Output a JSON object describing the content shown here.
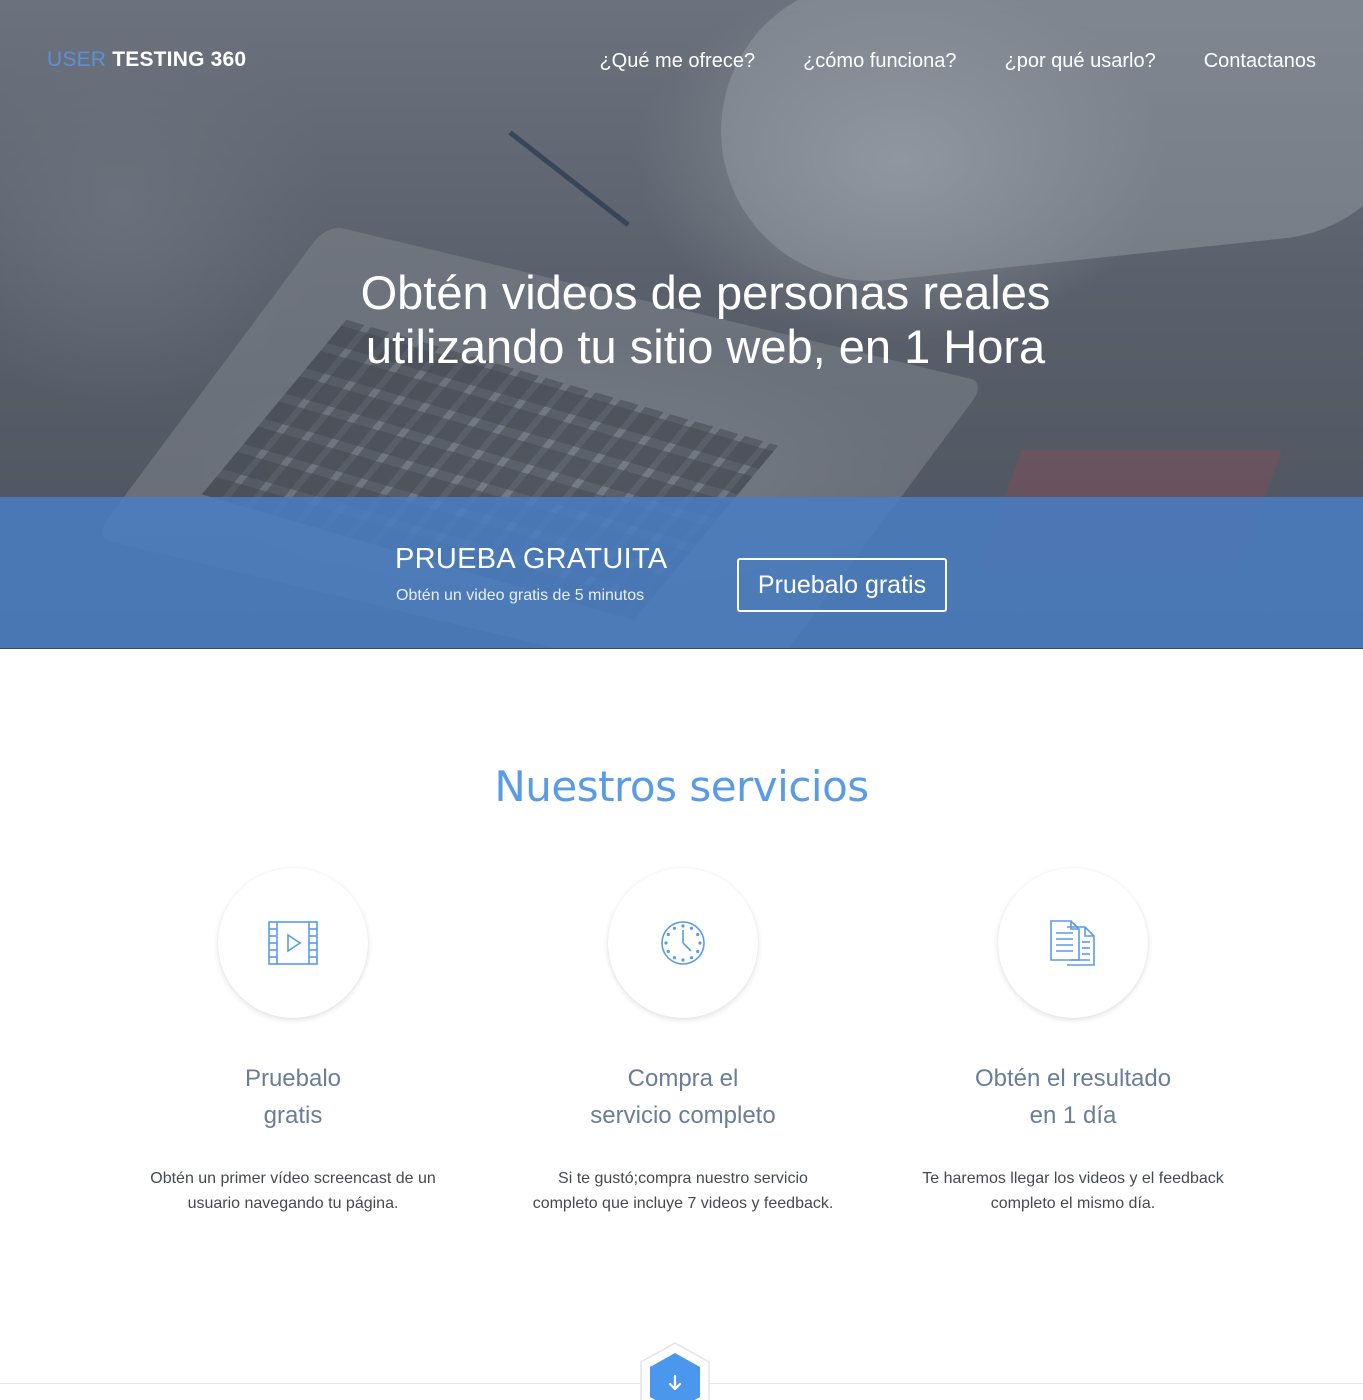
{
  "logo": {
    "part_a": "USER",
    "part_b": "TESTING 360"
  },
  "nav": {
    "items": [
      {
        "label": "¿Qué me ofrece?"
      },
      {
        "label": "¿cómo funciona?"
      },
      {
        "label": "¿por qué usarlo?"
      },
      {
        "label": "Contactanos"
      }
    ]
  },
  "hero": {
    "line1": "Obtén videos de personas reales",
    "line2": "utilizando tu sitio web, en 1 Hora"
  },
  "cta": {
    "title": "PRUEBA GRATUITA",
    "subtitle": "Obtén un video gratis de 5 minutos",
    "button_label": "Pruebalo gratis"
  },
  "services": {
    "title": "Nuestros servicios",
    "items": [
      {
        "icon": "video-film-icon",
        "title_line1": "Pruebalo",
        "title_line2": "gratis",
        "desc_line1": "Obtén un primer vídeo screencast de un",
        "desc_line2": "usuario navegando tu página."
      },
      {
        "icon": "clock-icon",
        "title_line1": "Compra el",
        "title_line2": "servicio completo",
        "desc_line1": "Si te gustó;compra nuestro servicio",
        "desc_line2": "completo que incluye 7 videos y feedback."
      },
      {
        "icon": "documents-icon",
        "title_line1": "Obtén el resultado",
        "title_line2": "en 1 día",
        "desc_line1": "Te haremos llegar los videos y el feedback",
        "desc_line2": "completo el mismo día."
      }
    ]
  },
  "colors": {
    "accent": "#5a9be8",
    "cta_band": "#487ec3",
    "heading_muted": "#6a7e98"
  }
}
